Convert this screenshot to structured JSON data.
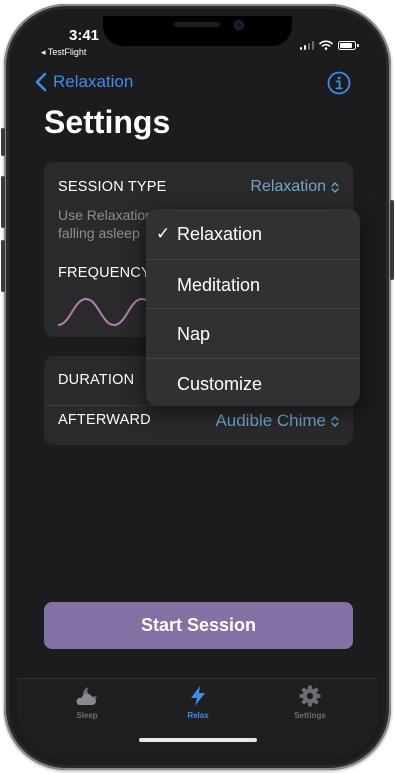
{
  "status_bar": {
    "time": "3:41",
    "back_app": "◂ TestFlight"
  },
  "nav": {
    "back_label": "Relaxation",
    "info_icon": "info-circle-icon"
  },
  "page": {
    "title": "Settings"
  },
  "session_card": {
    "session_type_label": "SESSION TYPE",
    "session_type_value": "Relaxation",
    "description_line1": "Use Relaxation",
    "description_line2": "falling asleep",
    "frequency_label": "FREQUENCY"
  },
  "duration_card": {
    "duration_label": "DURATION",
    "afterward_label": "AFTERWARD",
    "afterward_value": "Audible Chime"
  },
  "dropdown": {
    "items": [
      {
        "label": "Relaxation",
        "check": "✓",
        "selected": true
      },
      {
        "label": "Meditation",
        "check": "",
        "selected": false
      },
      {
        "label": "Nap",
        "check": "",
        "selected": false
      },
      {
        "label": "Customize",
        "check": "",
        "selected": false
      }
    ]
  },
  "start_button": {
    "label": "Start Session"
  },
  "tab_bar": {
    "tabs": [
      {
        "label": "Sleep",
        "icon": "cloud-moon-icon",
        "active": false
      },
      {
        "label": "Relax",
        "icon": "bolt-icon",
        "active": true
      },
      {
        "label": "Settings",
        "icon": "gear-icon",
        "active": false
      }
    ]
  },
  "colors": {
    "accent_blue": "#3e8ce8",
    "value_teal": "#6fa7c9",
    "start_button_purple": "#8371a4",
    "wave_pink": "#b77fb1",
    "background": "#1c1c1f",
    "card": "#2a2a2d"
  }
}
